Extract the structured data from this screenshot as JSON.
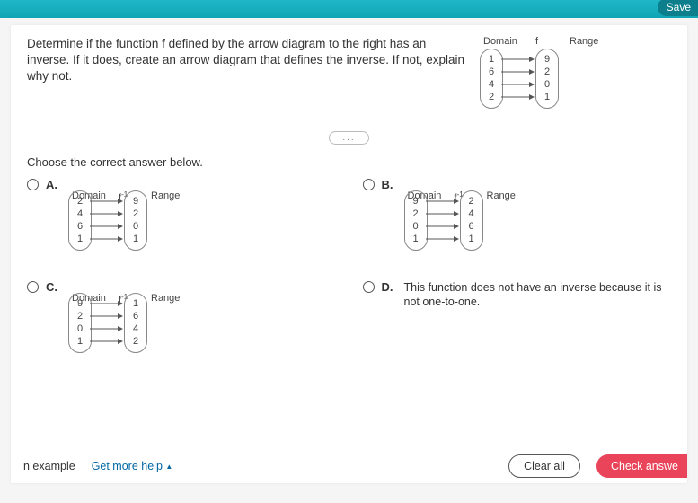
{
  "topbar": {
    "save": "Save"
  },
  "question": {
    "text": "Determine if the function f defined by the arrow diagram to the right has an inverse. If it does, create an arrow diagram that defines the inverse. If not, explain why not.",
    "diagram": {
      "domain_lbl": "Domain",
      "f_lbl": "f",
      "range_lbl": "Range",
      "domain": [
        "1",
        "6",
        "4",
        "2"
      ],
      "range": [
        "9",
        "2",
        "0",
        "1"
      ]
    }
  },
  "separator": "...",
  "instruction": "Choose the correct answer below.",
  "choices": {
    "a": {
      "letter": "A.",
      "finv": "f",
      "finv_sup": "-1",
      "domain_lbl": "Domain",
      "range_lbl": "Range",
      "domain": [
        "2",
        "4",
        "6",
        "1"
      ],
      "range": [
        "9",
        "2",
        "0",
        "1"
      ]
    },
    "b": {
      "letter": "B.",
      "finv": "f",
      "finv_sup": "-1",
      "domain_lbl": "Domain",
      "range_lbl": "Range",
      "domain": [
        "9",
        "2",
        "0",
        "1"
      ],
      "range": [
        "2",
        "4",
        "6",
        "1"
      ]
    },
    "c": {
      "letter": "C.",
      "finv": "f",
      "finv_sup": "-1",
      "domain_lbl": "Domain",
      "range_lbl": "Range",
      "domain": [
        "9",
        "2",
        "0",
        "1"
      ],
      "range": [
        "1",
        "6",
        "4",
        "2"
      ]
    },
    "d": {
      "letter": "D.",
      "text": "This function does not have an inverse because it is not one-to-one."
    }
  },
  "footer": {
    "example": "n example",
    "help": "Get more help",
    "clear": "Clear all",
    "check": "Check answe"
  }
}
